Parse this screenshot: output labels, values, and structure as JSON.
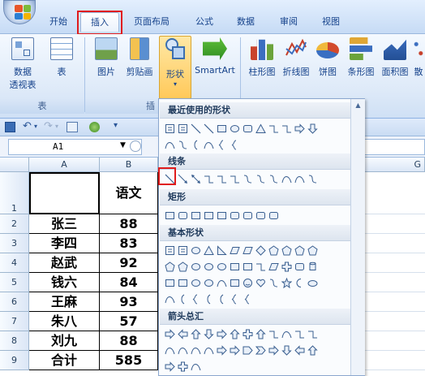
{
  "tabs": [
    {
      "label": "开始"
    },
    {
      "label": "插入"
    },
    {
      "label": "页面布局"
    },
    {
      "label": "公式"
    },
    {
      "label": "数据"
    },
    {
      "label": "审阅"
    },
    {
      "label": "视图"
    }
  ],
  "ribbon": {
    "pivot_label_line1": "数据",
    "pivot_label_line2": "透视表",
    "table_label": "表",
    "picture_label": "图片",
    "clipart_label": "剪贴画",
    "shapes_label": "形状",
    "smartart_label": "SmartArt",
    "column_chart_label": "柱形图",
    "line_chart_label": "折线图",
    "pie_chart_label": "饼图",
    "bar_chart_label": "条形图",
    "area_chart_label": "面积图",
    "more_chart_label": "散",
    "group_tables": "表",
    "group_illustrations": "插"
  },
  "formula_bar": {
    "name_box": "A1"
  },
  "columns": [
    "A",
    "B"
  ],
  "col_g": "G",
  "rows": [
    {
      "num": "1",
      "name": "",
      "score": "语文"
    },
    {
      "num": "2",
      "name": "张三",
      "score": "88"
    },
    {
      "num": "3",
      "name": "李四",
      "score": "83"
    },
    {
      "num": "4",
      "name": "赵武",
      "score": "92"
    },
    {
      "num": "5",
      "name": "钱六",
      "score": "84"
    },
    {
      "num": "6",
      "name": "王麻",
      "score": "93"
    },
    {
      "num": "7",
      "name": "朱八",
      "score": "57"
    },
    {
      "num": "8",
      "name": "刘九",
      "score": "88"
    },
    {
      "num": "9",
      "name": "合计",
      "score": "585"
    }
  ],
  "shapes_menu": {
    "recent_header": "最近使用的形状",
    "lines_header": "线条",
    "rect_header": "矩形",
    "basic_header": "基本形状",
    "arrows_header": "箭头总汇"
  },
  "colors": {
    "highlight": "#e01c1c",
    "ribbon_text": "#15428b"
  }
}
